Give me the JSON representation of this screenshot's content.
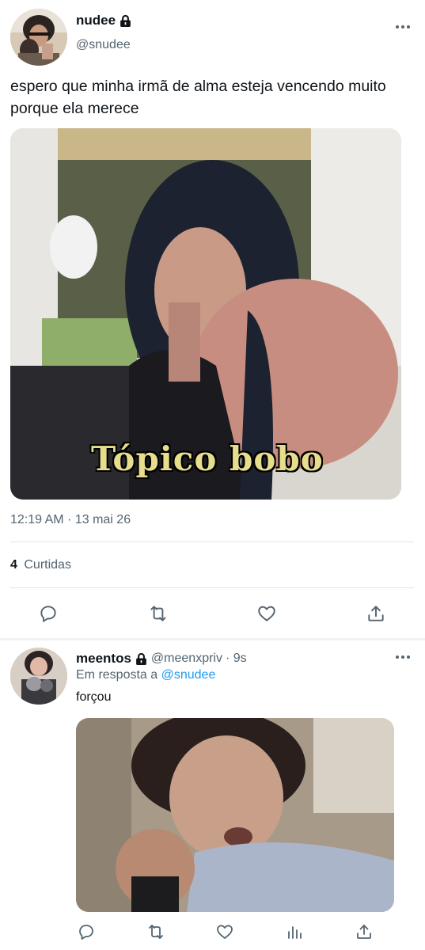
{
  "tweet": {
    "display_name": "nudee",
    "handle": "@snudee",
    "text": "espero que minha irmã de alma esteja vencendo muito porque ela merece",
    "image_caption": "Tópico bobo",
    "timestamp": "12:19 AM · 13 mai 26",
    "likes_count": "4",
    "likes_label": "Curtidas"
  },
  "reply": {
    "display_name": "meentos",
    "handle": "@meenxpriv",
    "time": "· 9s",
    "reply_prefix": "Em resposta a",
    "reply_to": "@snudee",
    "text": "forçou"
  },
  "icons": {
    "lock": "lock-icon",
    "more": "more-icon",
    "reply": "reply-icon",
    "retweet": "retweet-icon",
    "like": "heart-icon",
    "share": "share-icon",
    "analytics": "analytics-icon"
  },
  "colors": {
    "link": "#1d9bf0",
    "muted": "#536471",
    "text": "#0f1419",
    "divider": "#e1e5e8",
    "caption": "#e6de8c"
  }
}
